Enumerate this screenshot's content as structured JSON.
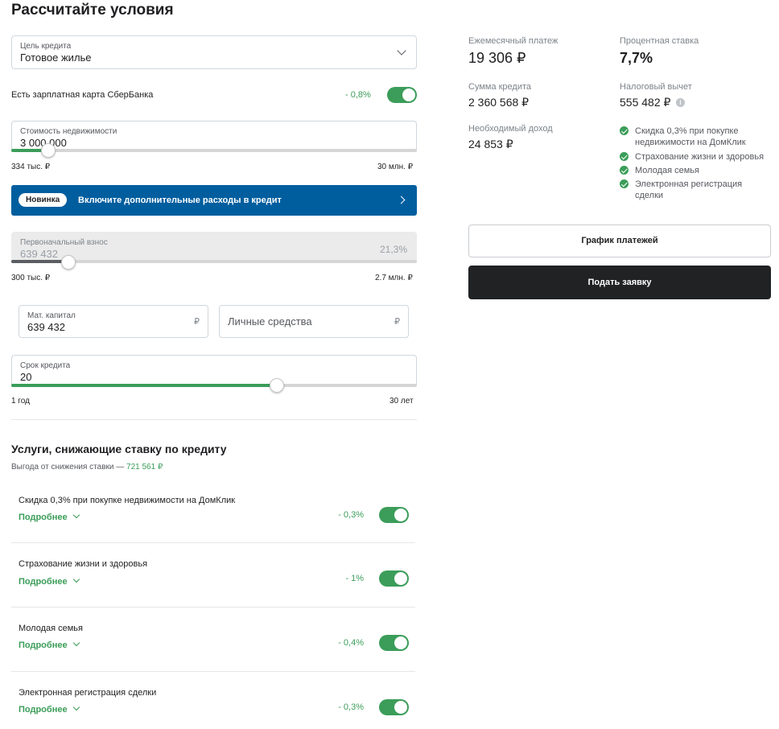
{
  "page_title": "Рассчитайте условия",
  "purpose": {
    "label": "Цель кредита",
    "value": "Готовое жилье"
  },
  "salary_card": {
    "label": "Есть зарплатная карта СберБанка",
    "rate": "- 0,8%",
    "enabled": true
  },
  "property_cost": {
    "label": "Стоимость недвижимости",
    "value": "3 000 000",
    "min_label": "334 тыс. ₽",
    "max_label": "30 млн. ₽",
    "fraction": 0.09
  },
  "banner": {
    "badge": "Новинка",
    "text": "Включите дополнительные расходы в кредит"
  },
  "down_payment": {
    "label": "Первоначальный взнос",
    "value": "639 432",
    "percent": "21,3%",
    "min_label": "300 тыс. ₽",
    "max_label": "2.7 млн. ₽",
    "fraction": 0.142
  },
  "mat_capital": {
    "label": "Мат. капитал",
    "value": "639 432",
    "currency": "₽"
  },
  "own_funds": {
    "placeholder": "Личные средства",
    "currency": "₽"
  },
  "term": {
    "label": "Срок кредита",
    "value": "20",
    "min_label": "1 год",
    "max_label": "30 лет",
    "fraction": 0.655
  },
  "services": {
    "title": "Услуги, снижающие ставку по кредиту",
    "benefit_prefix": "Выгода от снижения ставки — ",
    "benefit_value": "721 561 ₽",
    "more_label": "Подробнее",
    "items": [
      {
        "title": "Скидка 0,3% при покупке недвижимости на ДомКлик",
        "rate": "- 0,3%",
        "enabled": true
      },
      {
        "title": "Страхование жизни и здоровья",
        "rate": "- 1%",
        "enabled": true
      },
      {
        "title": "Молодая семья",
        "rate": "- 0,4%",
        "enabled": true
      },
      {
        "title": "Электронная регистрация сделки",
        "rate": "- 0,3%",
        "enabled": true
      }
    ]
  },
  "results": {
    "monthly_label": "Ежемесячный платеж",
    "monthly_value": "19 306 ₽",
    "rate_label": "Процентная ставка",
    "rate_value": "7,7%",
    "loan_label": "Сумма кредита",
    "loan_value": "2 360 568 ₽",
    "tax_label": "Налоговый вычет",
    "tax_value": "555 482 ₽",
    "income_label": "Необходимый доход",
    "income_value": "24 853 ₽",
    "benefits": [
      "Скидка 0,3% при покупке недвижимости на ДомКлик",
      "Страхование жизни и здоровья",
      "Молодая семья",
      "Электронная регистрация сделки"
    ]
  },
  "buttons": {
    "schedule": "График платежей",
    "apply": "Подать заявку"
  },
  "colors": {
    "accent": "#3b9d59",
    "banner": "#005e9f",
    "dark_button": "#212224"
  }
}
